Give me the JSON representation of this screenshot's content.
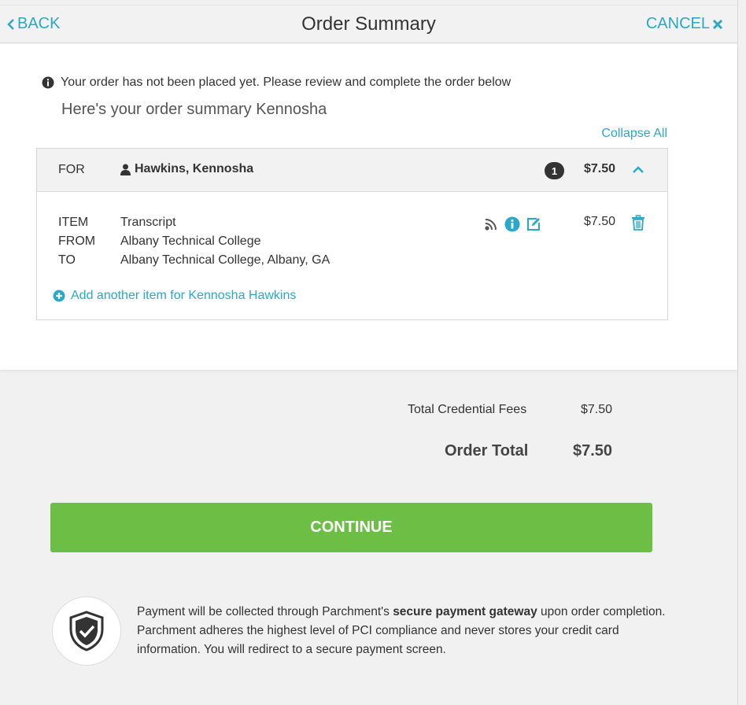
{
  "header": {
    "back_label": "BACK",
    "title": "Order Summary",
    "cancel_label": "CANCEL"
  },
  "notice": {
    "text": "Your order has not been placed yet. Please review and complete the order below",
    "subtitle": "Here's your order summary Kennosha"
  },
  "collapse_all_label": "Collapse All",
  "recipient": {
    "for_label": "FOR",
    "name": "Hawkins, Kennosha",
    "item_count": "1",
    "price": "$7.50"
  },
  "item": {
    "labels": {
      "item": "ITEM",
      "from": "FROM",
      "to": "TO"
    },
    "item_value": "Transcript",
    "from_value": "Albany Technical College",
    "to_value": "Albany Technical College, Albany, GA",
    "price": "$7.50",
    "icons": [
      "electronic-delivery-icon",
      "info-icon",
      "edit-icon",
      "trash-icon"
    ]
  },
  "add_item_label": "Add another item for Kennosha Hawkins",
  "totals": {
    "fees_label": "Total Credential Fees",
    "fees_value": "$7.50",
    "order_total_label": "Order Total",
    "order_total_value": "$7.50"
  },
  "continue_label": "CONTINUE",
  "secure": {
    "part1": "Payment will be collected through Parchment's ",
    "bold": "secure payment gateway",
    "part2": " upon order completion. Parchment adheres the highest level of PCI compliance and never stores your credit card information. You will redirect to a secure payment screen."
  },
  "colors": {
    "accent": "#2aa8c9",
    "continue": "#6cbe45",
    "badge": "#333333"
  }
}
